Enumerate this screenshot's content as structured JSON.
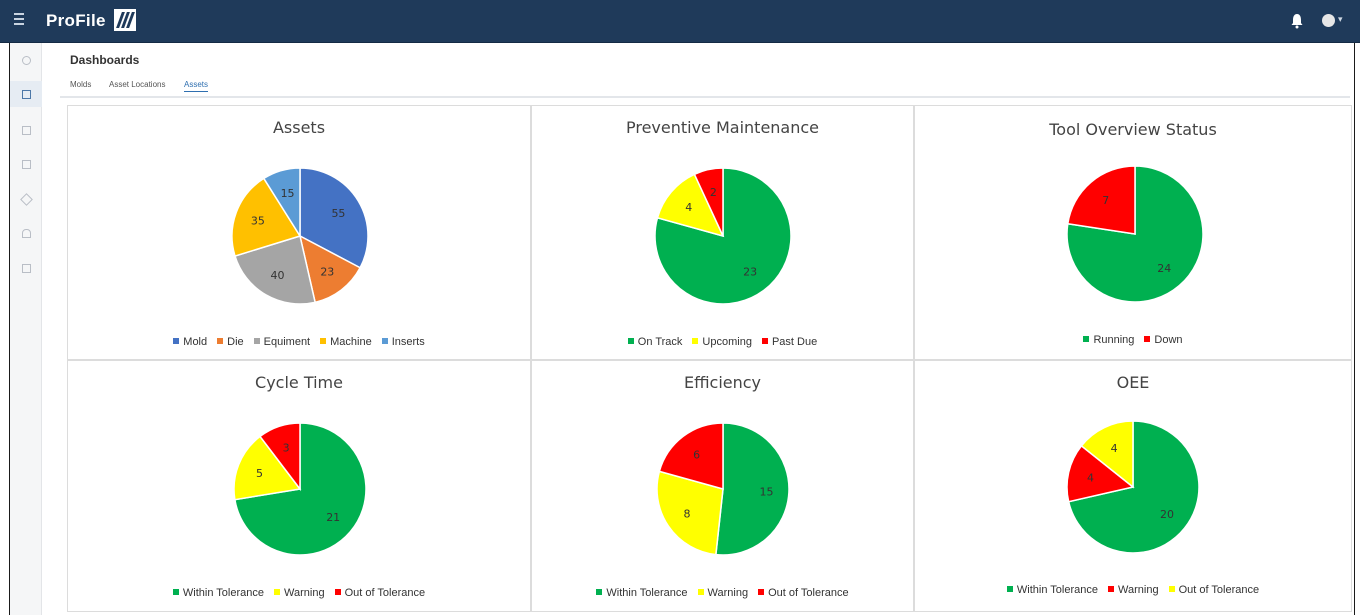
{
  "app": {
    "brand": "ProFile"
  },
  "page": {
    "title": "Dashboards"
  },
  "tabs": [
    {
      "label": "Molds",
      "active": false
    },
    {
      "label": "Asset Locations",
      "active": false
    },
    {
      "label": "Assets",
      "active": true
    }
  ],
  "sidebar": {
    "icons": [
      "settings-icon",
      "dashboard-icon",
      "assets-icon",
      "calendar-icon",
      "wrench-icon",
      "alert-icon",
      "report-icon"
    ]
  },
  "chart_data": [
    {
      "type": "pie",
      "title": "Assets",
      "series": [
        {
          "name": "Mold",
          "value": 55,
          "color": "#4472c4"
        },
        {
          "name": "Die",
          "value": 23,
          "color": "#ed7d31"
        },
        {
          "name": "Equiment",
          "value": 40,
          "color": "#a5a5a5"
        },
        {
          "name": "Machine",
          "value": 35,
          "color": "#ffc000"
        },
        {
          "name": "Inserts",
          "value": 15,
          "color": "#5b9bd5"
        }
      ]
    },
    {
      "type": "pie",
      "title": "Preventive Maintenance",
      "series": [
        {
          "name": "On Track",
          "value": 23,
          "color": "#00b050"
        },
        {
          "name": "Upcoming",
          "value": 4,
          "color": "#ffff00"
        },
        {
          "name": "Past Due",
          "value": 2,
          "color": "#ff0000"
        }
      ]
    },
    {
      "type": "pie",
      "title": "Tool Overview Status",
      "series": [
        {
          "name": "Running",
          "value": 24,
          "color": "#00b050"
        },
        {
          "name": "Down",
          "value": 7,
          "color": "#ff0000"
        }
      ]
    },
    {
      "type": "pie",
      "title": "Cycle Time",
      "series": [
        {
          "name": "Within Tolerance",
          "value": 21,
          "color": "#00b050"
        },
        {
          "name": "Warning",
          "value": 5,
          "color": "#ffff00"
        },
        {
          "name": "Out of Tolerance",
          "value": 3,
          "color": "#ff0000"
        }
      ]
    },
    {
      "type": "pie",
      "title": "Efficiency",
      "series": [
        {
          "name": "Within Tolerance",
          "value": 15,
          "color": "#00b050"
        },
        {
          "name": "Warning",
          "value": 8,
          "color": "#ffff00"
        },
        {
          "name": "Out of Tolerance",
          "value": 6,
          "color": "#ff0000"
        }
      ]
    },
    {
      "type": "pie",
      "title": "OEE",
      "series": [
        {
          "name": "Within Tolerance",
          "value": 20,
          "color": "#00b050"
        },
        {
          "name": "Warning",
          "value": 4,
          "color": "#ff0000"
        },
        {
          "name": "Out of Tolerance",
          "value": 4,
          "color": "#ffff00"
        }
      ],
      "slice_order": [
        0,
        1,
        2
      ]
    }
  ]
}
